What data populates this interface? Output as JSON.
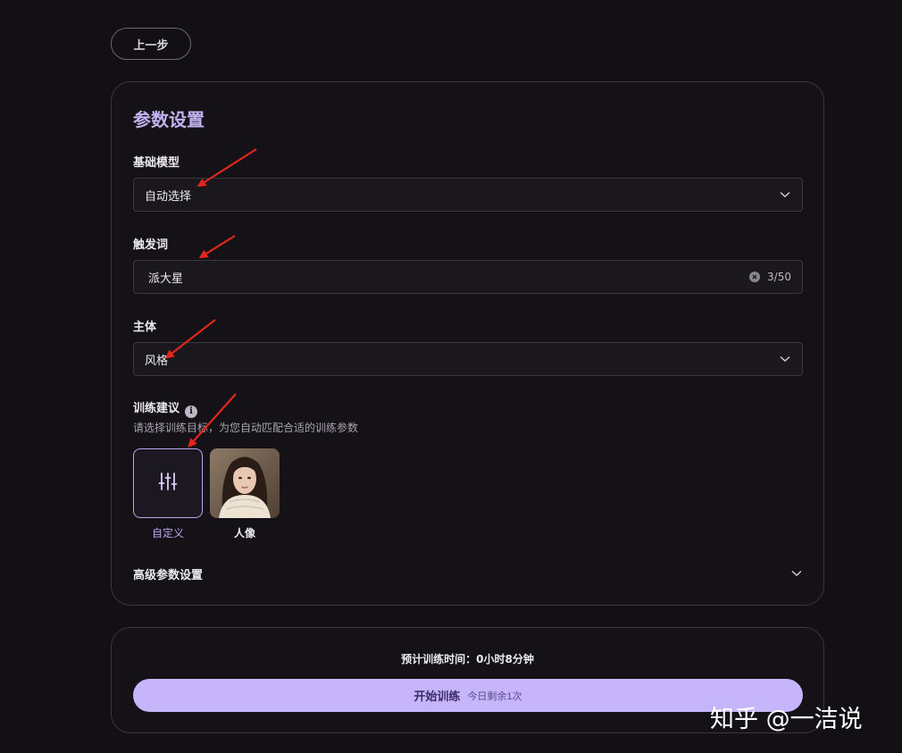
{
  "nav": {
    "back_label": "上一步"
  },
  "params": {
    "title": "参数设置",
    "base_model": {
      "label": "基础模型",
      "value": "自动选择"
    },
    "trigger_word": {
      "label": "触发词",
      "value": "派大星",
      "count": "3/50"
    },
    "subject": {
      "label": "主体",
      "value": "风格"
    },
    "suggestion": {
      "label": "训练建议",
      "info_icon": "i",
      "hint": "请选择训练目标，为您自动匹配合适的训练参数",
      "options": [
        {
          "label": "自定义",
          "icon": "sliders-icon",
          "selected": true
        },
        {
          "label": "人像",
          "icon": "portrait-thumbnail",
          "selected": false
        }
      ]
    },
    "advanced_label": "高级参数设置"
  },
  "footer": {
    "estimate": "预计训练时间：0小时8分钟",
    "start_label": "开始训练",
    "remaining": "今日剩余1次"
  },
  "annotations": {
    "arrow_color": "#e2261b"
  },
  "watermark": "知乎 @一洁说"
}
